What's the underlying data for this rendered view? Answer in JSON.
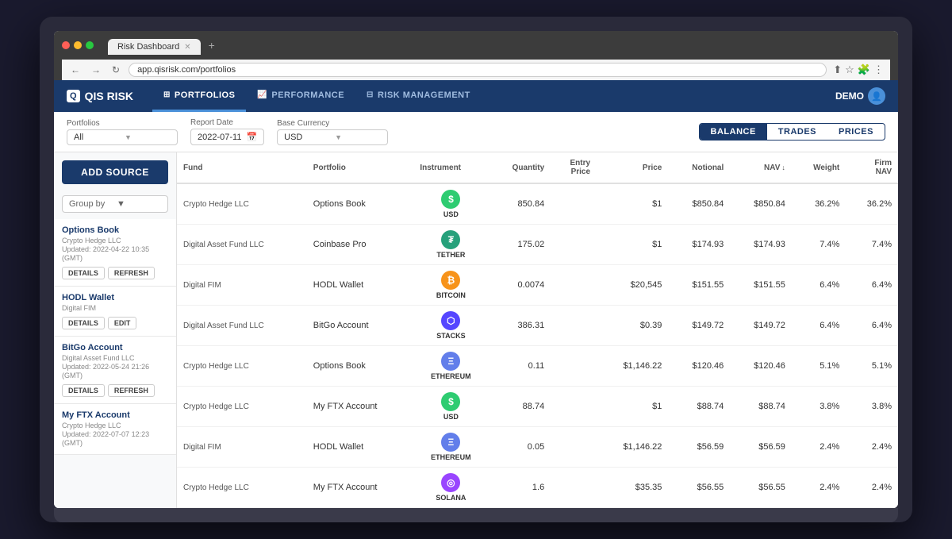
{
  "browser": {
    "url": "app.qisrisk.com/portfolios",
    "tab_title": "Risk Dashboard",
    "nav_back": "←",
    "nav_forward": "→",
    "nav_refresh": "↻"
  },
  "app": {
    "logo_text": "QIS RISK",
    "logo_box": "Q",
    "nav_items": [
      {
        "label": "PORTFOLIOS",
        "icon": "⊞",
        "active": true
      },
      {
        "label": "PERFORMANCE",
        "icon": "📈",
        "active": false
      },
      {
        "label": "RISK MANAGEMENT",
        "icon": "⊟",
        "active": false
      }
    ],
    "demo_label": "DEMO"
  },
  "toolbar": {
    "portfolios_label": "Portfolios",
    "portfolios_value": "All",
    "report_date_label": "Report Date",
    "report_date_value": "2022-07-11",
    "base_currency_label": "Base Currency",
    "base_currency_value": "USD",
    "toggle_buttons": [
      "BALANCE",
      "TRADES",
      "PRICES"
    ],
    "active_toggle": "BALANCE"
  },
  "sidebar": {
    "add_source_label": "ADD SOURCE",
    "group_by_label": "Group by",
    "sources": [
      {
        "name": "Options Book",
        "sub1": "Crypto Hedge LLC",
        "sub2": "Updated: 2022-04-22 10:35",
        "sub3": "(GMT)",
        "actions": [
          "DETAILS",
          "REFRESH"
        ]
      },
      {
        "name": "HODL Wallet",
        "sub1": "Digital FIM",
        "sub2": "",
        "sub3": "",
        "actions": [
          "DETAILS",
          "EDIT"
        ]
      },
      {
        "name": "BitGo Account",
        "sub1": "Digital Asset Fund LLC",
        "sub2": "Updated: 2022-05-24 21:26",
        "sub3": "(GMT)",
        "actions": [
          "DETAILS",
          "REFRESH"
        ]
      },
      {
        "name": "My FTX Account",
        "sub1": "Crypto Hedge LLC",
        "sub2": "Updated: 2022-07-07 12:23",
        "sub3": "(GMT)",
        "actions": []
      }
    ]
  },
  "table": {
    "columns": [
      "Fund",
      "Portfolio",
      "Instrument",
      "Quantity",
      "Entry Price",
      "Price",
      "Notional",
      "NAV",
      "Weight",
      "Firm NAV"
    ],
    "rows": [
      {
        "fund": "Crypto Hedge LLC",
        "portfolio": "Options Book",
        "instrument_name": "USD",
        "instrument_color": "#2ecc71",
        "instrument_symbol": "$",
        "quantity": "850.84",
        "entry_price": "",
        "price": "$1",
        "notional": "$850.84",
        "nav": "$850.84",
        "weight": "36.2%",
        "firm_nav": "36.2%"
      },
      {
        "fund": "Digital Asset Fund LLC",
        "portfolio": "Coinbase Pro",
        "instrument_name": "TETHER",
        "instrument_color": "#26a17b",
        "instrument_symbol": "₮",
        "quantity": "175.02",
        "entry_price": "",
        "price": "$1",
        "notional": "$174.93",
        "nav": "$174.93",
        "weight": "7.4%",
        "firm_nav": "7.4%"
      },
      {
        "fund": "Digital FIM",
        "portfolio": "HODL Wallet",
        "instrument_name": "BITCOIN",
        "instrument_color": "#f7931a",
        "instrument_symbol": "₿",
        "quantity": "0.0074",
        "entry_price": "",
        "price": "$20,545",
        "notional": "$151.55",
        "nav": "$151.55",
        "weight": "6.4%",
        "firm_nav": "6.4%"
      },
      {
        "fund": "Digital Asset Fund LLC",
        "portfolio": "BitGo Account",
        "instrument_name": "STACKS",
        "instrument_color": "#5546ff",
        "instrument_symbol": "⬡",
        "quantity": "386.31",
        "entry_price": "",
        "price": "$0.39",
        "notional": "$149.72",
        "nav": "$149.72",
        "weight": "6.4%",
        "firm_nav": "6.4%"
      },
      {
        "fund": "Crypto Hedge LLC",
        "portfolio": "Options Book",
        "instrument_name": "ETHEREUM",
        "instrument_color": "#627eea",
        "instrument_symbol": "Ξ",
        "quantity": "0.11",
        "entry_price": "",
        "price": "$1,146.22",
        "notional": "$120.46",
        "nav": "$120.46",
        "weight": "5.1%",
        "firm_nav": "5.1%"
      },
      {
        "fund": "Crypto Hedge LLC",
        "portfolio": "My FTX Account",
        "instrument_name": "USD",
        "instrument_color": "#2ecc71",
        "instrument_symbol": "$",
        "quantity": "88.74",
        "entry_price": "",
        "price": "$1",
        "notional": "$88.74",
        "nav": "$88.74",
        "weight": "3.8%",
        "firm_nav": "3.8%"
      },
      {
        "fund": "Digital FIM",
        "portfolio": "HODL Wallet",
        "instrument_name": "ETHEREUM",
        "instrument_color": "#627eea",
        "instrument_symbol": "Ξ",
        "quantity": "0.05",
        "entry_price": "",
        "price": "$1,146.22",
        "notional": "$56.59",
        "nav": "$56.59",
        "weight": "2.4%",
        "firm_nav": "2.4%"
      },
      {
        "fund": "Crypto Hedge LLC",
        "portfolio": "My FTX Account",
        "instrument_name": "SOLANA",
        "instrument_color": "#9945ff",
        "instrument_symbol": "◎",
        "quantity": "1.6",
        "entry_price": "",
        "price": "$35.35",
        "notional": "$56.55",
        "nav": "$56.55",
        "weight": "2.4%",
        "firm_nav": "2.4%"
      }
    ]
  }
}
